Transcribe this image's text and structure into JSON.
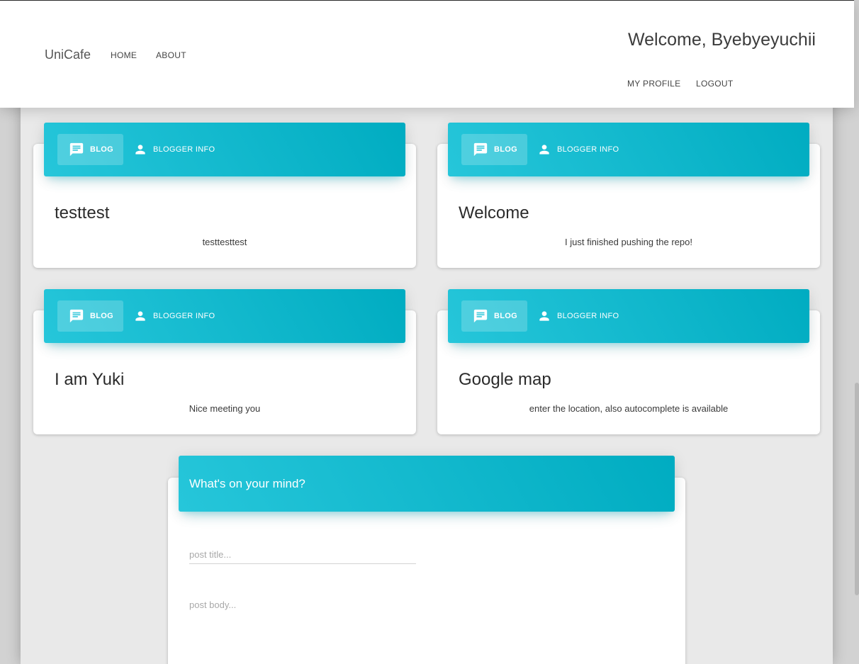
{
  "navbar": {
    "brand": "UniCafe",
    "links": [
      "HOME",
      "ABOUT"
    ],
    "welcome": "Welcome, Byebyeyuchii",
    "right_links": [
      "MY PROFILE",
      "LOGOUT"
    ]
  },
  "colors": {
    "accent_start": "#26c6da",
    "accent_end": "#00acc1"
  },
  "posts": [
    {
      "tab_blog": "BLOG",
      "tab_info": "BLOGGER INFO",
      "title": "testtest",
      "body": "testtesttest"
    },
    {
      "tab_blog": "BLOG",
      "tab_info": "BLOGGER INFO",
      "title": "Welcome",
      "body": "I just finished pushing the repo!"
    },
    {
      "tab_blog": "BLOG",
      "tab_info": "BLOGGER INFO",
      "title": "I am Yuki",
      "body": "Nice meeting you"
    },
    {
      "tab_blog": "BLOG",
      "tab_info": "BLOGGER INFO",
      "title": "Google map",
      "body": "enter the location, also autocomplete is available"
    }
  ],
  "new_post": {
    "header": "What's on your mind?",
    "title_placeholder": "post title...",
    "body_placeholder": "post body..."
  },
  "icons": {
    "blog_tab": "chat-icon",
    "info_tab": "person-icon"
  }
}
